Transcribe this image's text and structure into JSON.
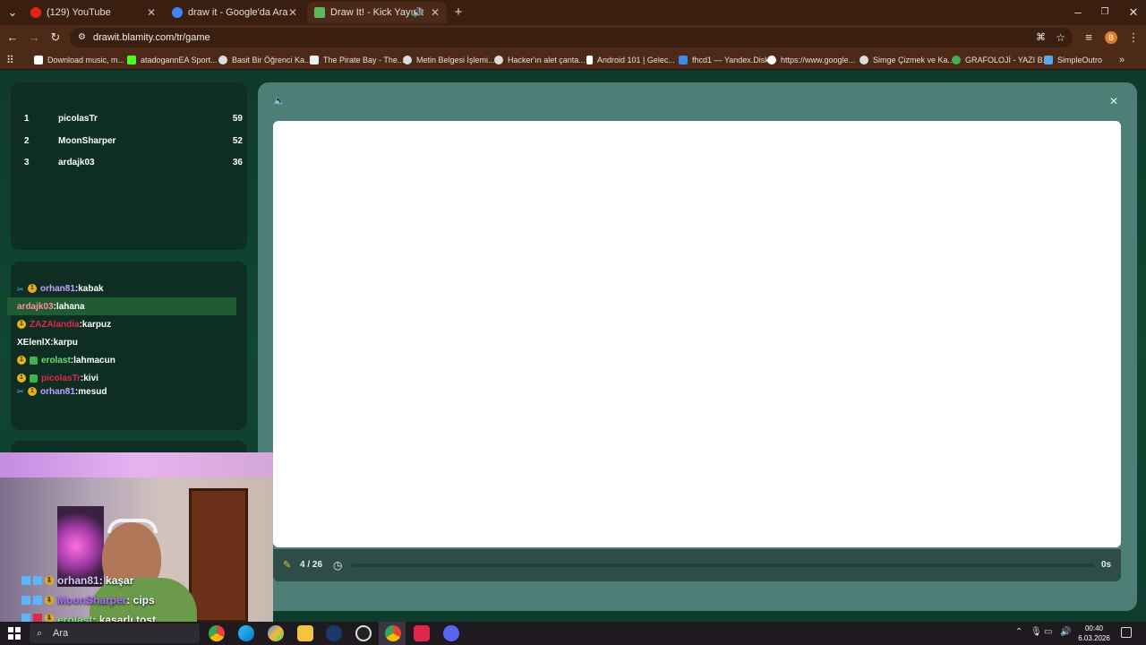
{
  "browser": {
    "tabs": [
      {
        "label": "(129) YouTube",
        "color": "#e62117"
      },
      {
        "label": "draw it - Google'da Ara",
        "color": "#4285f4"
      },
      {
        "label": "Draw It! - Kick Yayınları İçin",
        "color": "#5cb85c"
      }
    ],
    "url": "drawit.blamity.com/tr/game",
    "bookmarks": [
      "Download music, m...",
      "atadogannEA Sport...",
      "Basit Bir Öğrenci Ka...",
      "The Pirate Bay - The...",
      "Metin Belgesi İşlemi...",
      "Hacker'ın alet çanta...",
      "Android 101 | Gelec...",
      "fhcd1 — Yandex.Disk",
      "https://www.google...",
      "Simge Çizmek ve Ka...",
      "GRAFOLOJİ - YAZI B...",
      "SimpleOutro"
    ],
    "profile_initial": "B"
  },
  "leaderboard": [
    {
      "rank": "1",
      "name": "picolasTr",
      "score": "59"
    },
    {
      "rank": "2",
      "name": "MoonSharper",
      "score": "52"
    },
    {
      "rank": "3",
      "name": "ardajk03",
      "score": "36"
    }
  ],
  "chat": [
    {
      "user": "orhan81",
      "msg": ":kabak",
      "color": "#c9a0ff"
    },
    {
      "user": "ardajk03",
      "msg": ":lahana",
      "color": "#ff8fa3"
    },
    {
      "user": "ZAZAlandia",
      "msg": ":karpuz",
      "color": "#e0284a"
    },
    {
      "user": "XElenlX",
      "msg": ":karpu",
      "color": "#ffffff"
    },
    {
      "user": "erolast",
      "msg": ":lahmacun",
      "color": "#6fe06a"
    },
    {
      "user": "picolasTr",
      "msg": ":kivi",
      "color": "#e0284a"
    },
    {
      "user": "orhan81",
      "msg": ":mesud",
      "color": "#c9a0ff"
    }
  ],
  "game": {
    "round": "4 / 26",
    "timer": "0s",
    "progress": 0
  },
  "webcam_chat": [
    {
      "user": "orhan81",
      "msg": " : kaşar",
      "color": "#d9c7ff"
    },
    {
      "user": "MoonSharper",
      "msg": " : cips",
      "color": "#b36bff"
    },
    {
      "user": "erolast",
      "msg": " : kaşarlı tost",
      "color": "#7cf07a"
    }
  ],
  "taskbar": {
    "search_placeholder": "Ara",
    "time": "00:40",
    "date": "6.03.2026"
  }
}
